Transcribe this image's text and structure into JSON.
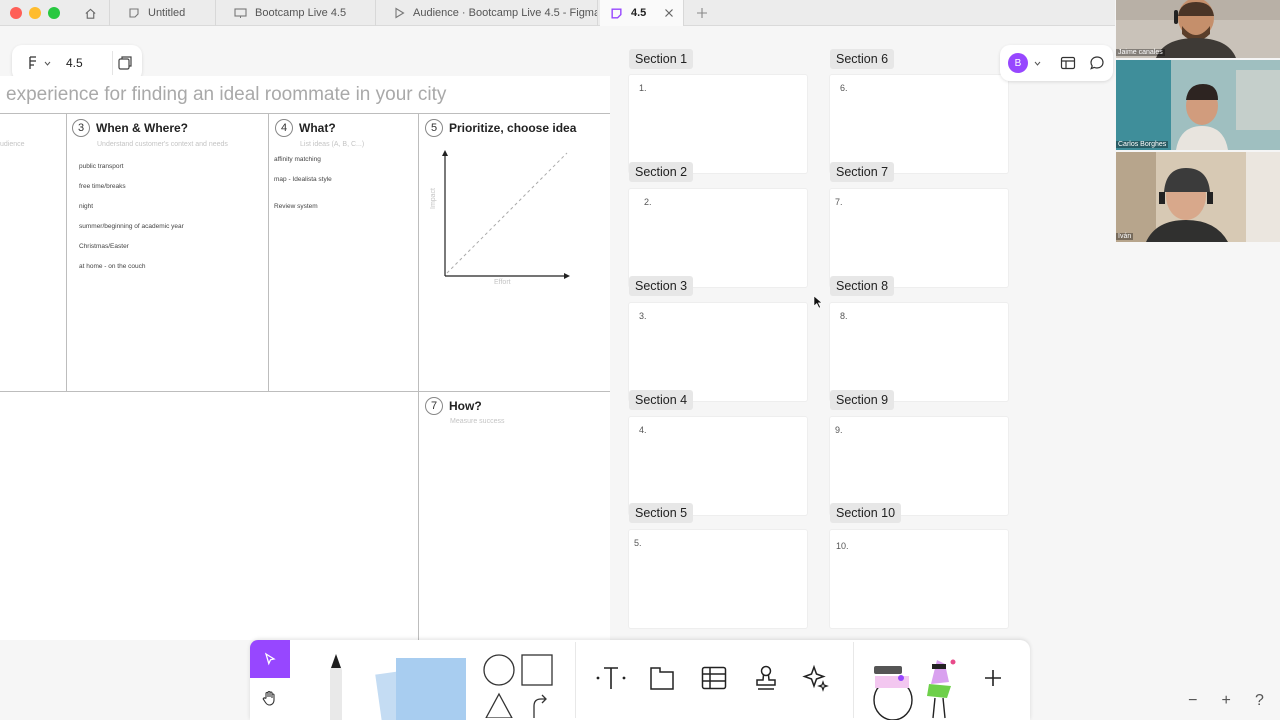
{
  "tabs": [
    {
      "label": ""
    },
    {
      "label": "Untitled"
    },
    {
      "label": "Bootcamp Live 4.5"
    },
    {
      "label": "Audience · Bootcamp Live 4.5 - Figma"
    },
    {
      "label": "4.5"
    }
  ],
  "file": {
    "name": "4.5"
  },
  "board": {
    "title": "experience for finding an ideal roommate in your city",
    "col_left_sub": "udience",
    "col3": {
      "num": "3",
      "title": "When & Where?",
      "sub": "Understand customer's context and needs",
      "items": [
        "public transport",
        "free time/breaks",
        "night",
        "summer/beginning of academic year",
        "Christmas/Easter",
        "at home - on the couch"
      ]
    },
    "col4": {
      "num": "4",
      "title": "What?",
      "sub": "List ideas (A, B, C...)",
      "items": [
        "affinity matching",
        "map - Idealista style",
        "Review system"
      ]
    },
    "col5": {
      "num": "5",
      "title": "Prioritize, choose idea",
      "ylabel": "Impact",
      "xlabel": "Effort"
    },
    "col7": {
      "num": "7",
      "title": "How?",
      "sub": "Measure success"
    }
  },
  "sections": [
    {
      "label": "Section 1",
      "num": "1."
    },
    {
      "label": "Section 2",
      "num": "2."
    },
    {
      "label": "Section 3",
      "num": "3."
    },
    {
      "label": "Section 4",
      "num": "4."
    },
    {
      "label": "Section 5",
      "num": "5."
    },
    {
      "label": "Section 6",
      "num": "6."
    },
    {
      "label": "Section 7",
      "num": "7."
    },
    {
      "label": "Section 8",
      "num": "8."
    },
    {
      "label": "Section 9",
      "num": "9."
    },
    {
      "label": "Section 10",
      "num": "10."
    }
  ],
  "collab": {
    "avatar": "B"
  },
  "participants": [
    {
      "name": "Jaime canales"
    },
    {
      "name": "Carlos Borghes"
    },
    {
      "name": "Iván"
    }
  ],
  "zoom": {
    "minus": "−",
    "plus": "+",
    "help": "?"
  },
  "colors": {
    "accent": "#9747ff",
    "board": "#ffffff",
    "canvas": "#f6f6f6"
  }
}
